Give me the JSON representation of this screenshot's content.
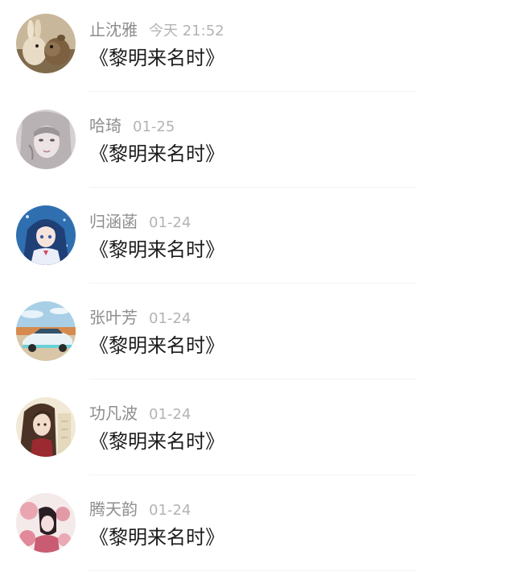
{
  "comments": [
    {
      "name": "止沈雅",
      "time": "今天 21:52",
      "text": "《黎明来名时》",
      "avatar_icon": "rabbit-avatar-icon"
    },
    {
      "name": "哈琦",
      "time": "01-25",
      "text": "《黎明来名时》",
      "avatar_icon": "sketch-girl-avatar-icon"
    },
    {
      "name": "归涵菡",
      "time": "01-24",
      "text": "《黎明来名时》",
      "avatar_icon": "anime-girl-avatar-icon"
    },
    {
      "name": "张叶芳",
      "time": "01-24",
      "text": "《黎明来名时》",
      "avatar_icon": "car-avatar-icon"
    },
    {
      "name": "功凡波",
      "time": "01-24",
      "text": "《黎明来名时》",
      "avatar_icon": "long-hair-girl-avatar-icon"
    },
    {
      "name": "腾天韵",
      "time": "01-24",
      "text": "《黎明来名时》",
      "avatar_icon": "pink-art-avatar-icon"
    }
  ]
}
